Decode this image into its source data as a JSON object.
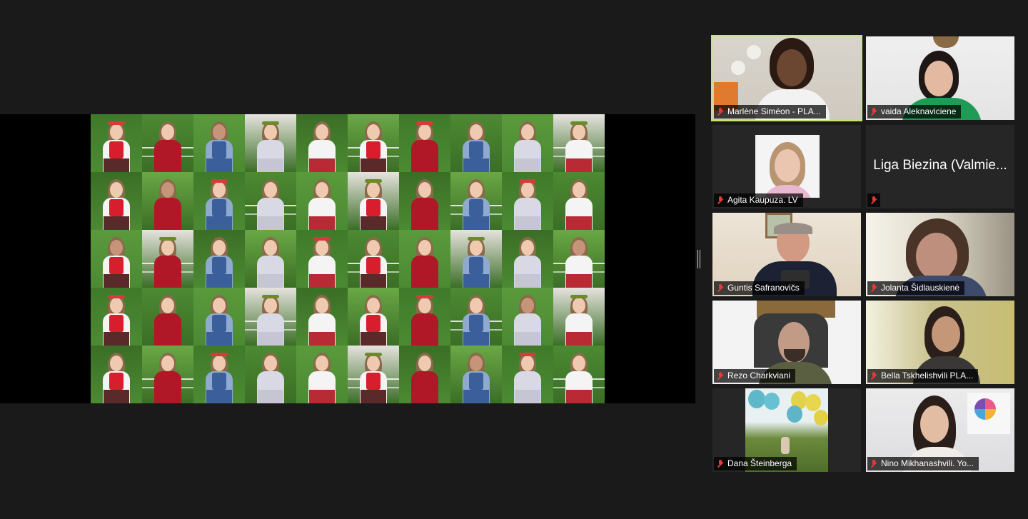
{
  "participants": [
    {
      "name": "Marlène Siméon - PLA...",
      "active": true
    },
    {
      "name": "vaida Aleknaviciene"
    },
    {
      "name": "Agita Kaupuza. LV"
    },
    {
      "name": "",
      "big_label": "Liga Biezina (Valmie..."
    },
    {
      "name": "Guntis Safranovičs"
    },
    {
      "name": "Jolanta Šidlauskienė"
    },
    {
      "name": "Rezo Charkviani"
    },
    {
      "name": "Bella Tskhelishvili PLA..."
    },
    {
      "name": "Dana Šteinberga"
    },
    {
      "name": "Nino Mikhanashvili. Yo..."
    }
  ],
  "icons": {
    "mic": "mic-muted-icon"
  },
  "colors": {
    "active_border": "#c6e56b",
    "muted_mic": "#e23b3b",
    "background": "#1a1a1a"
  }
}
